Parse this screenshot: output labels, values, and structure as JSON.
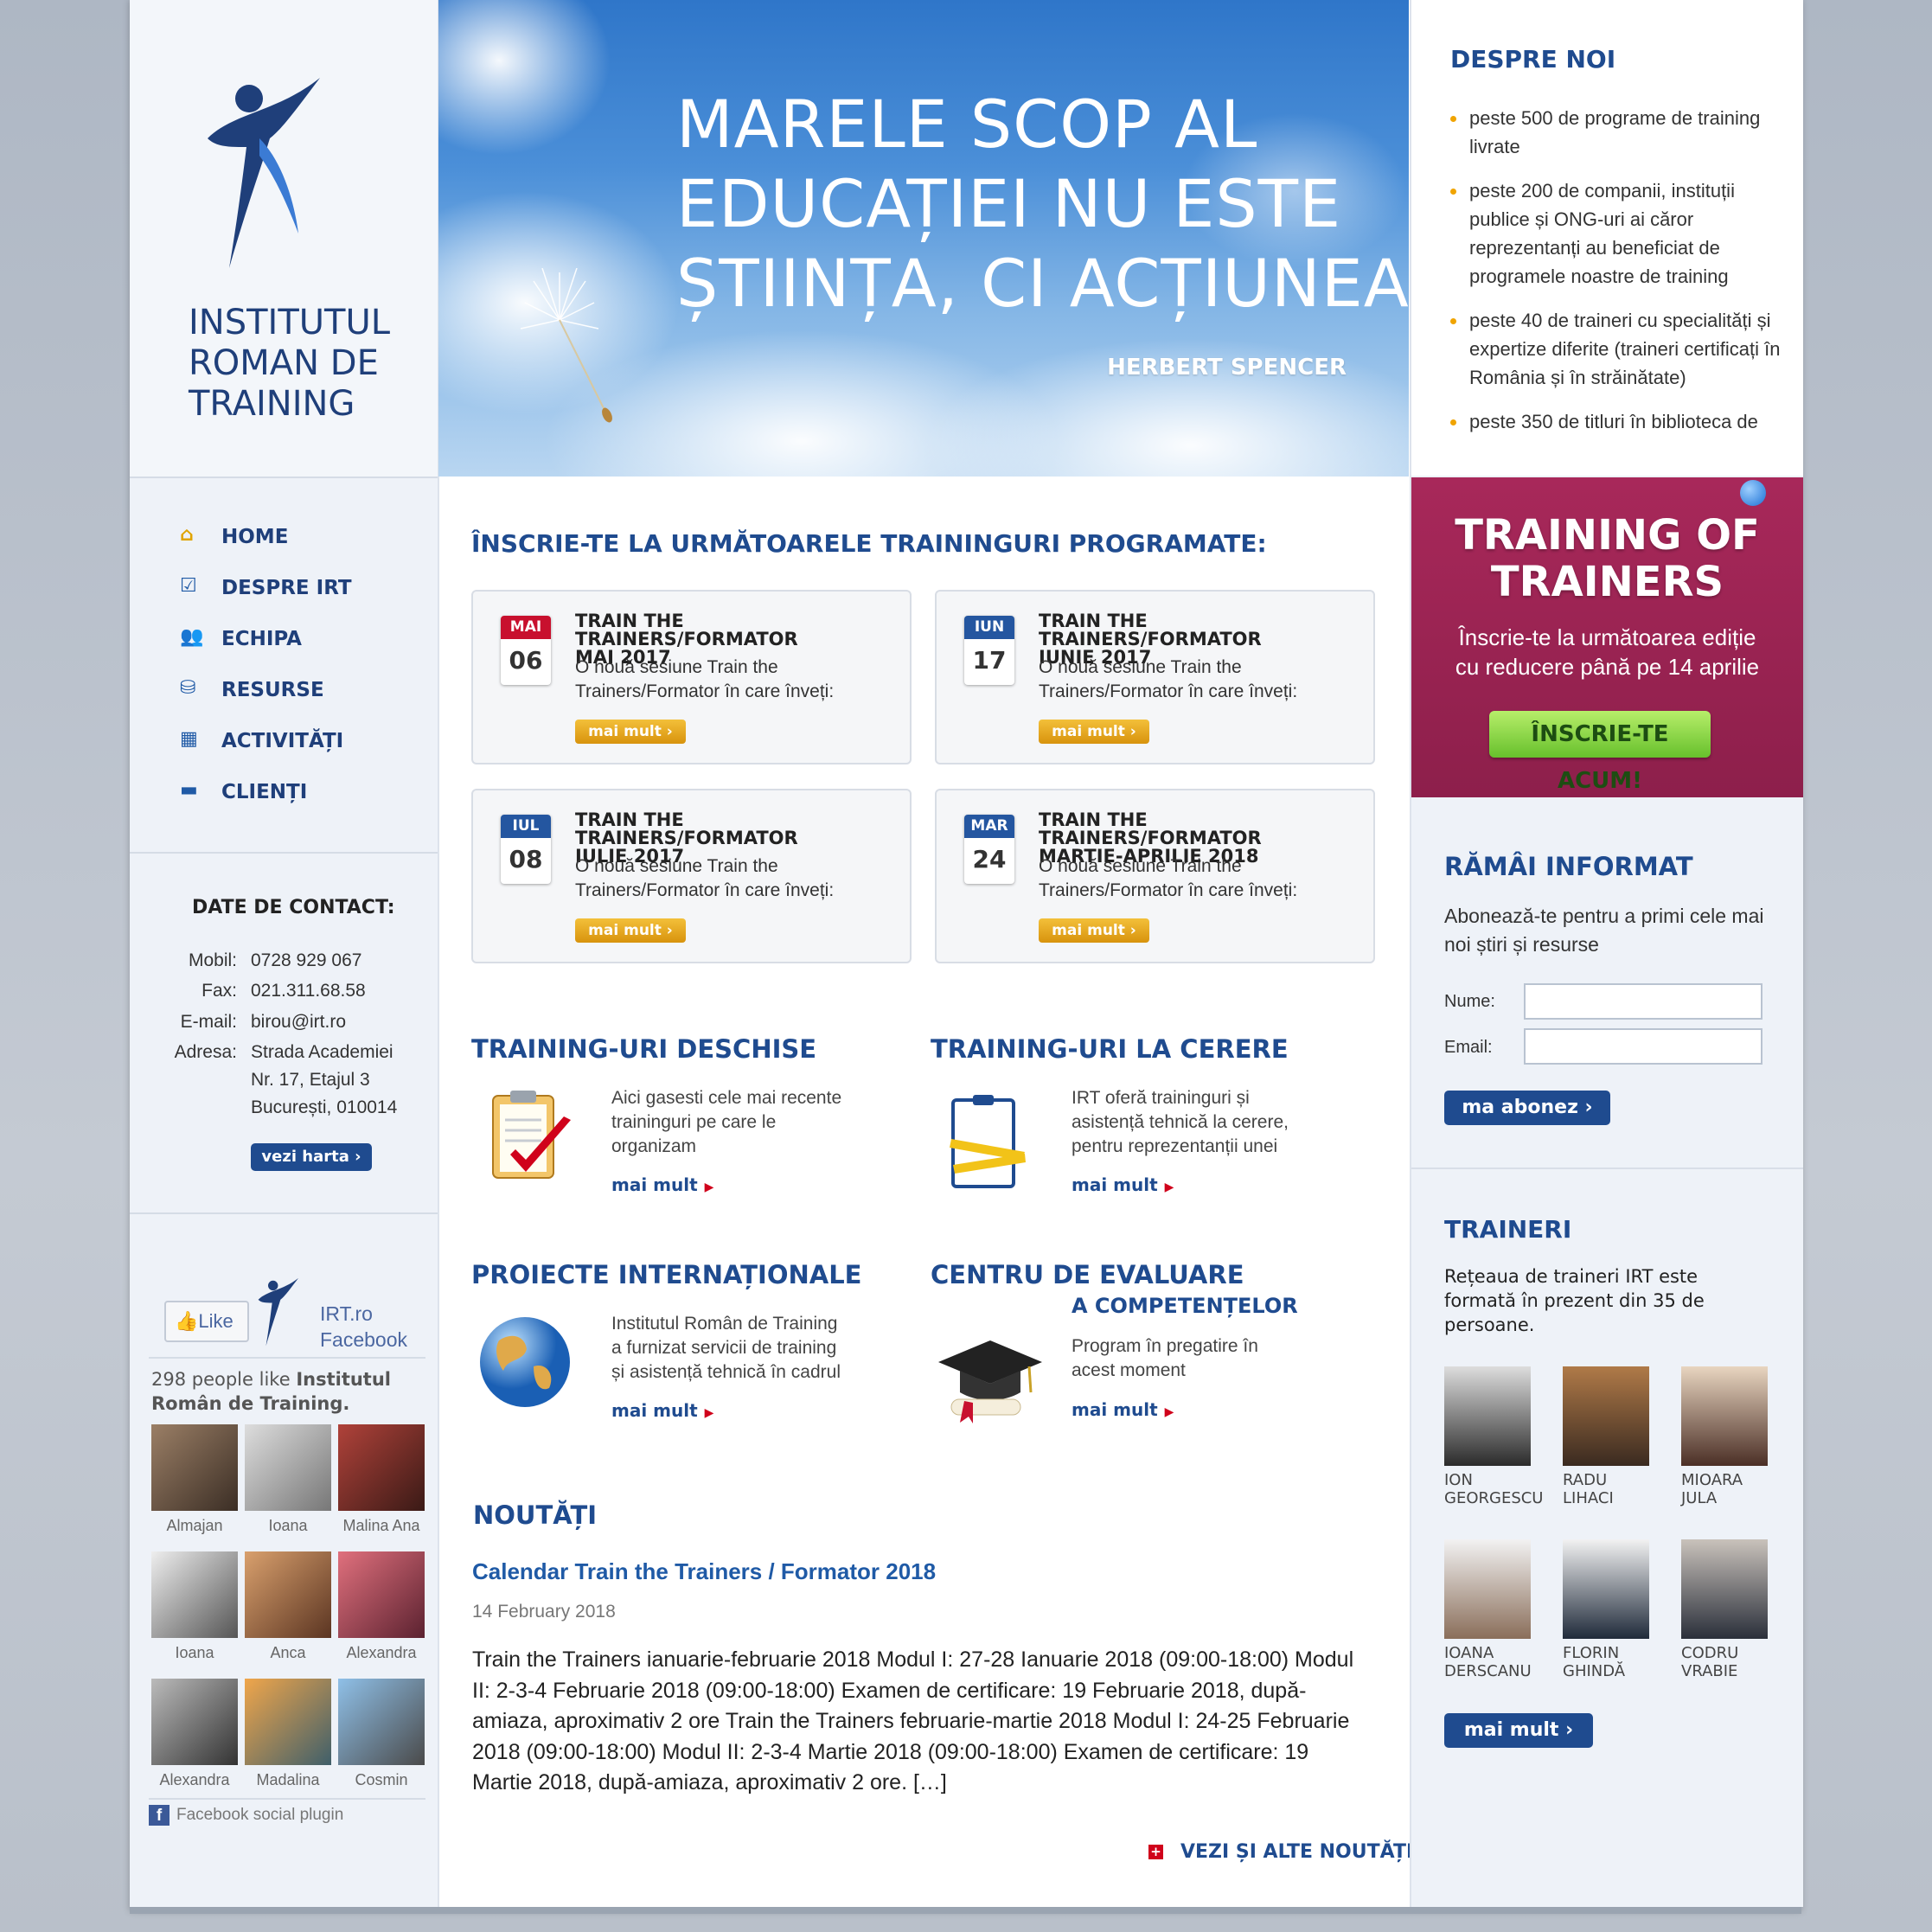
{
  "logo": {
    "line1": "INSTITUTUL",
    "line2": "ROMAN DE",
    "line3": "TRAINING"
  },
  "hero": {
    "line1": "MARELE SCOP AL",
    "line2": "EDUCAȚIEI NU ESTE",
    "line3": "ȘTIINȚA, CI ACȚIUNEA",
    "author": "HERBERT SPENCER"
  },
  "nav": {
    "items": [
      {
        "label": "HOME",
        "icon": "home-icon"
      },
      {
        "label": "DESPRE IRT",
        "icon": "check-icon"
      },
      {
        "label": "ECHIPA",
        "icon": "team-icon"
      },
      {
        "label": "RESURSE",
        "icon": "resources-icon"
      },
      {
        "label": "ACTIVITĂȚI",
        "icon": "calendar-icon"
      },
      {
        "label": "CLIENȚI",
        "icon": "briefcase-icon"
      }
    ]
  },
  "contact": {
    "title": "DATE DE CONTACT:",
    "mobil_k": "Mobil:",
    "mobil": "0728 929 067",
    "fax_k": "Fax:",
    "fax": "021.311.68.58",
    "email_k": "E-mail:",
    "email": "birou@irt.ro",
    "adresa_k": "Adresa:",
    "adresa1": "Strada Academiei",
    "adresa2": "Nr. 17, Etajul 3",
    "adresa3": "București, 010014",
    "map_button": "vezi harta ›"
  },
  "facebook": {
    "like": "Like",
    "page1": "IRT.ro",
    "page2": "Facebook",
    "count_text": "298 people like",
    "count_name1": "Institutul",
    "count_name2": "Român de Training.",
    "people": [
      "Almajan",
      "Ioana",
      "Malina Ana",
      "Ioana",
      "Anca",
      "Alexandra",
      "Alexandra",
      "Madalina",
      "Cosmin"
    ],
    "plugin": "Facebook social plugin"
  },
  "scheduled": {
    "title": "ÎNSCRIE-TE LA URMĂTOARELE TRAININGURI PROGRAMATE:",
    "more": "mai mult ›",
    "cards": [
      {
        "month": "MAI",
        "day": "06",
        "color": "#c8102e",
        "t1": "TRAIN THE TRAINERS/FORMATOR",
        "t2": "MAI 2017",
        "desc": "O nouă sesiune Train the Trainers/Formator în care înveți:"
      },
      {
        "month": "IUN",
        "day": "17",
        "color": "#2456a0",
        "t1": "TRAIN THE TRAINERS/FORMATOR",
        "t2": "IUNIE 2017",
        "desc": "O nouă sesiune Train the Trainers/Formator în care înveți:"
      },
      {
        "month": "IUL",
        "day": "08",
        "color": "#2456a0",
        "t1": "TRAIN THE TRAINERS/FORMATOR",
        "t2": "IULIE 2017",
        "desc": "O nouă sesiune Train the Trainers/Formator în care înveți:"
      },
      {
        "month": "MAR",
        "day": "24",
        "color": "#2456a0",
        "t1": "TRAIN THE TRAINERS/FORMATOR",
        "t2": "MARTIE-APRILIE 2018",
        "desc": "O nouă sesiune Train the Trainers/Formator în care înveți:"
      }
    ]
  },
  "sections": {
    "open": {
      "title": "TRAINING-URI DESCHISE",
      "l1": "Aici gasesti cele mai recente",
      "l2": "traininguri pe care le",
      "l3": "organizam",
      "link": "mai mult"
    },
    "ondemand": {
      "title": "TRAINING-URI LA CERERE",
      "l1": "IRT oferă traininguri și",
      "l2": "asistență tehnică la cerere,",
      "l3": "pentru reprezentanții unei",
      "link": "mai mult"
    },
    "intl": {
      "title": "PROIECTE INTERNAȚIONALE",
      "l1": "Institutul Român de Training",
      "l2": "a furnizat servicii de training",
      "l3": "și asistență tehnică în cadrul",
      "link": "mai mult"
    },
    "eval": {
      "title1": "CENTRU DE EVALUARE",
      "title2": "A COMPETENȚELOR",
      "l1": "Program în pregatire în",
      "l2": "acest moment",
      "link": "mai mult"
    }
  },
  "news": {
    "title": "NOUTĂȚI",
    "post_title": "Calendar Train the Trainers / Formator 2018",
    "date": "14 February 2018",
    "body": "Train the Trainers ianuarie-februarie 2018 Modul I: 27-28 Ianuarie 2018 (09:00-18:00) Modul II: 2-3-4 Februarie 2018 (09:00-18:00) Examen de certificare: 19 Februarie 2018, după-amiaza, aproximativ 2 ore   Train the Trainers februarie-martie 2018 Modul I: 24-25 Februarie 2018 (09:00-18:00) Modul II: 2-3-4 Martie 2018 (09:00-18:00) Examen de certificare: 19 Martie 2018, după-amiaza, aproximativ 2 ore. […]",
    "more": "VEZI ȘI ALTE NOUTĂȚI"
  },
  "about": {
    "title": "DESPRE NOI",
    "items": [
      "peste 500 de programe de training livrate",
      "peste 200 de companii, instituții publice și ONG-uri ai căror reprezentanți au beneficiat de programele noastre de training",
      "peste 40 de traineri cu specialități și expertize diferite (traineri certificați în România și în străinătate)",
      "peste 350 de titluri în biblioteca de"
    ]
  },
  "tot": {
    "l1": "TRAINING OF",
    "l2": "TRAINERS",
    "s1": "Înscrie-te la următoarea ediție",
    "s2": "cu reducere până pe 14 aprilie",
    "button": "ÎNSCRIE-TE ACUM!"
  },
  "newsletter": {
    "title": "RĂMÂI INFORMAT",
    "text": "Abonează-te pentru a primi cele mai noi știri și resurse",
    "name_label": "Nume:",
    "email_label": "Email:",
    "button": "ma abonez ›"
  },
  "trainers": {
    "title": "TRAINERI",
    "intro": "Rețeaua de traineri IRT este formată în prezent din 35 de persoane.",
    "people": [
      {
        "a": "ION",
        "b": "GEORGESCU"
      },
      {
        "a": "RADU",
        "b": "LIHACI"
      },
      {
        "a": "MIOARA",
        "b": "JULA"
      },
      {
        "a": "IOANA",
        "b": "DERSCANU"
      },
      {
        "a": "FLORIN",
        "b": "GHINDĂ"
      },
      {
        "a": "CODRU",
        "b": "VRABIE"
      }
    ],
    "button": "mai mult ›"
  }
}
